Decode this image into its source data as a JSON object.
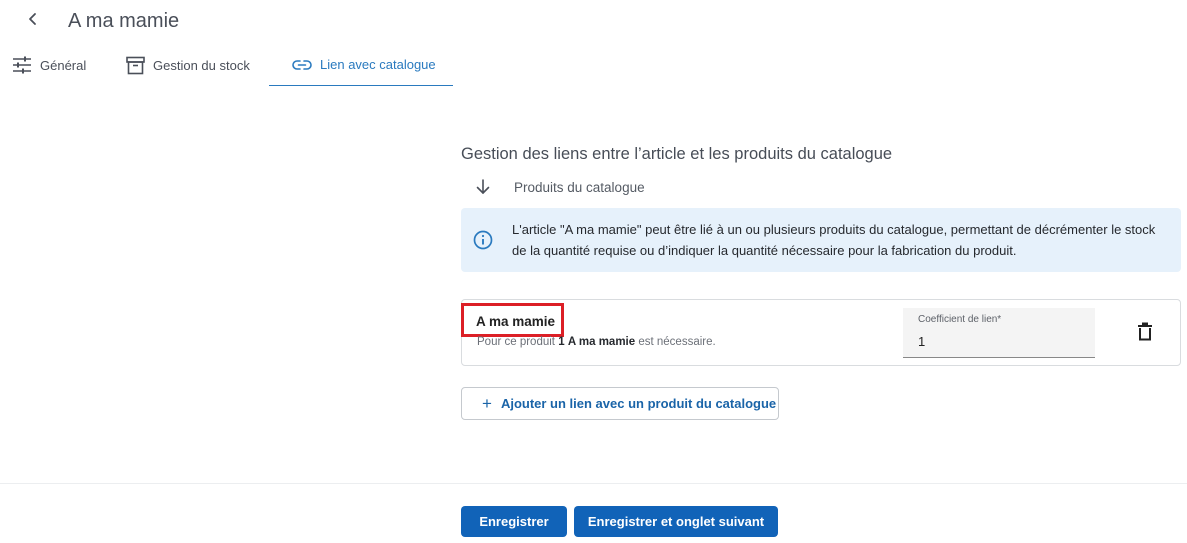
{
  "header": {
    "title": "A ma mamie",
    "back_icon": "chevron-left-icon"
  },
  "tabs": [
    {
      "label": "Général",
      "icon": "sliders-icon",
      "active": false
    },
    {
      "label": "Gestion du stock",
      "icon": "archive-box-icon",
      "active": false
    },
    {
      "label": "Lien avec catalogue",
      "icon": "link-icon",
      "active": true
    }
  ],
  "main": {
    "section_title": "Gestion des liens entre l’article et les produits du catalogue",
    "subsection_label": "Produits du catalogue",
    "info_text": "L'article \"A ma mamie\" peut être lié à un ou plusieurs produits du catalogue, permettant de décrémenter le stock de la quantité requise ou d’indiquer la quantité nécessaire pour la fabrication du produit.",
    "link": {
      "product_name": "A ma mamie",
      "desc_prefix": "Pour ce produit",
      "desc_qty": "1",
      "desc_product": "A ma mamie",
      "desc_suffix": "est nécessaire.",
      "coef_label": "Coefficient de lien*",
      "coef_value": "1"
    },
    "add_button_label": "Ajouter un lien avec un produit du catalogue"
  },
  "footer": {
    "save_label": "Enregistrer",
    "save_next_label": "Enregistrer et onglet suivant"
  },
  "colors": {
    "accent": "#2a7abf",
    "primary_button": "#1163b8",
    "info_bg": "#e6f1fb",
    "highlight": "#dc1f26"
  }
}
